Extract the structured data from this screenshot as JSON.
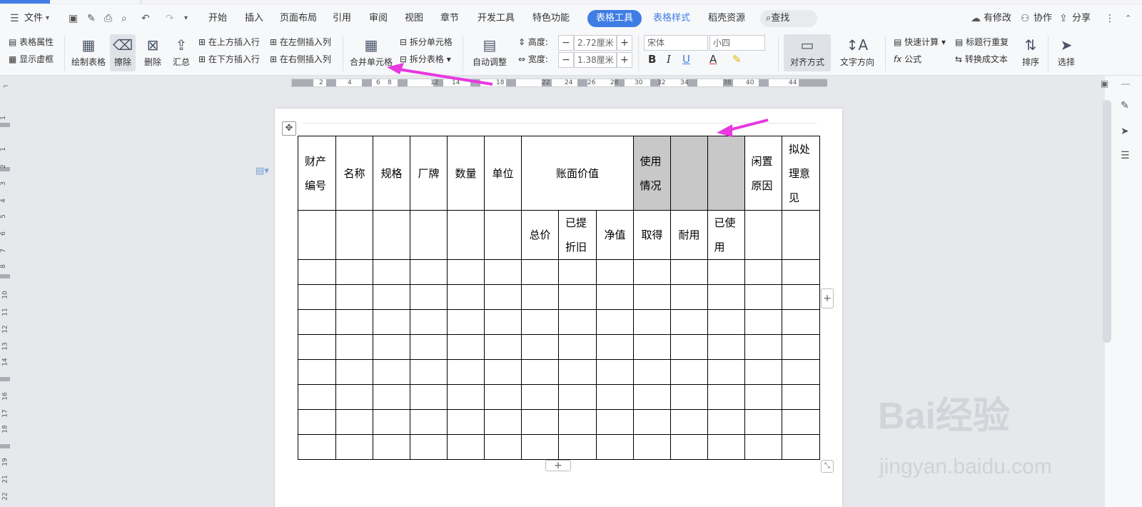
{
  "menu": {
    "file": "文件",
    "tabs": [
      "开始",
      "插入",
      "页面布局",
      "引用",
      "审阅",
      "视图",
      "章节",
      "开发工具",
      "特色功能"
    ],
    "active_tab": "表格工具",
    "table_style": "表格样式",
    "resources": "稻壳资源",
    "search": "查找",
    "modified": "有修改",
    "collab": "协作",
    "share": "分享"
  },
  "ribbon": {
    "table_props": "表格属性",
    "show_grid": "显示虚框",
    "draw_table": "绘制表格",
    "erase": "擦除",
    "delete": "删除",
    "summary": "汇总",
    "insert_above": "在上方插入行",
    "insert_below": "在下方插入行",
    "insert_left": "在左侧插入列",
    "insert_right": "在右侧插入列",
    "merge_cells": "合并单元格",
    "split_cells": "拆分单元格",
    "split_table": "拆分表格",
    "auto_adjust": "自动调整",
    "height_label": "高度:",
    "height_value": "2.72厘米",
    "width_label": "宽度:",
    "width_value": "1.38厘米",
    "font_name": "宋体",
    "font_size": "小四",
    "bold": "B",
    "italic": "I",
    "underline": "U",
    "font_color": "A",
    "align": "对齐方式",
    "text_dir": "文字方向",
    "quick_calc": "快速计算",
    "formula": "公式",
    "repeat_header": "标题行重复",
    "to_text": "转换成文本",
    "sort": "排序",
    "select": "选择"
  },
  "ruler": {
    "ticks": [
      "2",
      "4",
      "6",
      "8",
      "12",
      "14",
      "18",
      "22",
      "24",
      "26",
      "28",
      "30",
      "32",
      "34",
      "38",
      "40",
      "44"
    ]
  },
  "vruler": {
    "ticks": [
      "1",
      "2",
      "3",
      "4",
      "5",
      "6",
      "7",
      "8",
      "10",
      "11",
      "12",
      "13",
      "14",
      "15",
      "16",
      "17",
      "18",
      "19",
      "21",
      "22"
    ]
  },
  "table": {
    "header": {
      "asset_no": "财产编号",
      "name": "名称",
      "spec": "规格",
      "brand": "厂牌",
      "qty": "数量",
      "unit": "单位",
      "book_value": "账面价值",
      "usage": "使用情况",
      "idle_reason": "闲置原因",
      "proposal": "拟处理意见"
    },
    "sub": {
      "total": "总价",
      "depreciated": "已提折旧",
      "net": "净值",
      "acquired": "取得",
      "durable": "耐用",
      "used": "已使用"
    }
  },
  "watermark": {
    "brand": "Bai经验",
    "url": "jingyan.baidu.com"
  }
}
